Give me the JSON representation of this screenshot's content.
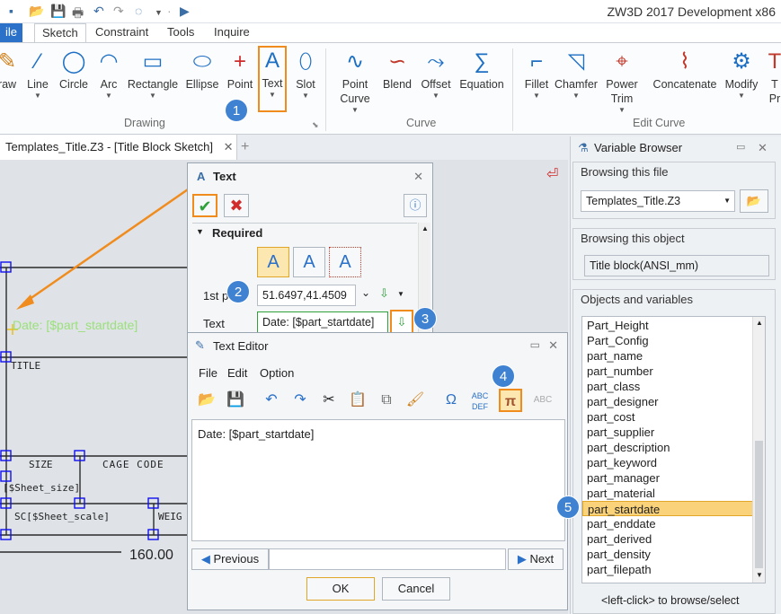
{
  "app": {
    "title": "ZW3D 2017 Development x86"
  },
  "ribbon": {
    "tabs": [
      "ile",
      "Sketch",
      "Constraint",
      "Tools",
      "Inquire"
    ],
    "buttons": [
      {
        "label": "raw",
        "icon": "draw-icon"
      },
      {
        "label": "Line",
        "icon": "line-icon"
      },
      {
        "label": "Circle",
        "icon": "circle-icon"
      },
      {
        "label": "Arc",
        "icon": "arc-icon"
      },
      {
        "label": "Rectangle",
        "icon": "rectangle-icon"
      },
      {
        "label": "Ellipse",
        "icon": "ellipse-icon"
      },
      {
        "label": "Point",
        "icon": "point-icon"
      },
      {
        "label": "Text",
        "icon": "text-icon"
      },
      {
        "label": "Slot",
        "icon": "slot-icon"
      },
      {
        "label": "Point Curve",
        "icon": "point-curve-icon"
      },
      {
        "label": "Blend",
        "icon": "blend-icon"
      },
      {
        "label": "Offset",
        "icon": "offset-icon"
      },
      {
        "label": "Equation",
        "icon": "equation-icon"
      },
      {
        "label": "Fillet",
        "icon": "fillet-icon"
      },
      {
        "label": "Chamfer",
        "icon": "chamfer-icon"
      },
      {
        "label": "Power Trim",
        "icon": "power-trim-icon"
      },
      {
        "label": "Concatenate",
        "icon": "concatenate-icon"
      },
      {
        "label": "Modify",
        "icon": "modify-icon"
      },
      {
        "label": "T Pr",
        "icon": "text-property-icon"
      }
    ],
    "groups": [
      "Drawing",
      "Curve",
      "Edit Curve"
    ]
  },
  "document": {
    "tab": "Templates_Title.Z3 - [Title Block Sketch]"
  },
  "canvas": {
    "date_text": "Date: [$part_startdate]",
    "labels": [
      "TITLE",
      "SIZE",
      "CAGE CODE",
      "[$Sheet_size]",
      "SC[$Sheet_scale]",
      "WEIG",
      "160.00"
    ]
  },
  "text_dialog": {
    "title": "Text",
    "section": "Required",
    "first_point_label": "1st p",
    "first_point_value": "51.6497,41.4509",
    "text_label": "Text",
    "text_value": "Date: [$part_startdate]"
  },
  "editor": {
    "title": "Text Editor",
    "menu": [
      "File",
      "Edit",
      "Option"
    ],
    "content": "Date: [$part_startdate]",
    "previous": "Previous",
    "next": "Next",
    "ok": "OK",
    "cancel": "Cancel"
  },
  "variable_browser": {
    "title": "Variable Browser",
    "browsing_file_label": "Browsing this file",
    "file_value": "Templates_Title.Z3",
    "browsing_object_label": "Browsing this object",
    "object_value": "Title block(ANSI_mm)",
    "objects_label": "Objects and variables",
    "items": [
      "Part_Height",
      "Part_Config",
      "part_name",
      "part_number",
      "part_class",
      "part_designer",
      "part_cost",
      "part_supplier",
      "part_description",
      "part_keyword",
      "part_manager",
      "part_material",
      "part_startdate",
      "part_enddate",
      "part_derived",
      "part_density",
      "part_filepath"
    ],
    "selected_index": 12,
    "footer": "<left-click> to browse/select"
  },
  "steps": [
    "1",
    "2",
    "3",
    "4",
    "5"
  ],
  "colors": {
    "accent": "#f08c1e",
    "badge": "#3f82d1",
    "selection": "#fad27a",
    "sketch_green": "#9be07a"
  }
}
